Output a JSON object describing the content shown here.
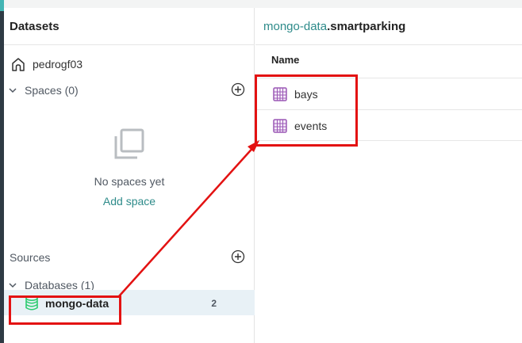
{
  "sidebar": {
    "title": "Datasets",
    "home": {
      "label": "pedrogf03",
      "icon": "home-icon"
    },
    "spaces": {
      "label": "Spaces (0)",
      "empty_text": "No spaces yet",
      "add_link": "Add space"
    },
    "sources": {
      "label": "Sources"
    },
    "databases": {
      "label": "Databases (1)"
    },
    "db_items": [
      {
        "label": "mongo-data",
        "count": "2",
        "icon": "database-icon"
      }
    ]
  },
  "main": {
    "breadcrumb": {
      "source": "mongo-data",
      "separator": ".",
      "current": "smartparking"
    },
    "column_header": "Name",
    "rows": [
      {
        "label": "bays",
        "icon": "table-icon"
      },
      {
        "label": "events",
        "icon": "table-icon"
      }
    ]
  },
  "colors": {
    "accent": "#2e8b8a",
    "highlight": "#e31212",
    "dataset_icon": "#9b59b6",
    "database_icon": "#2ecc71",
    "selected_row": "#e8f1f6"
  }
}
